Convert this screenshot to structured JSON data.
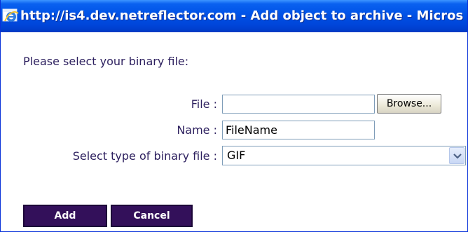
{
  "window": {
    "title": "http://is4.dev.netreflector.com - Add object to archive - Micros"
  },
  "form": {
    "prompt": "Please select your binary file:",
    "file_label": "File :",
    "file_value": "",
    "browse_label": "Browse...",
    "name_label": "Name :",
    "name_value": "FileName",
    "type_label": "Select type of binary file :",
    "type_selected": "GIF"
  },
  "actions": {
    "add_label": "Add",
    "cancel_label": "Cancel"
  },
  "colors": {
    "titlebar": "#0052e6",
    "label_text": "#2c1f5e",
    "button_bg": "#33105a"
  },
  "icons": {
    "window_icon": "internet-explorer-icon",
    "dropdown_icon": "chevron-down-icon"
  }
}
